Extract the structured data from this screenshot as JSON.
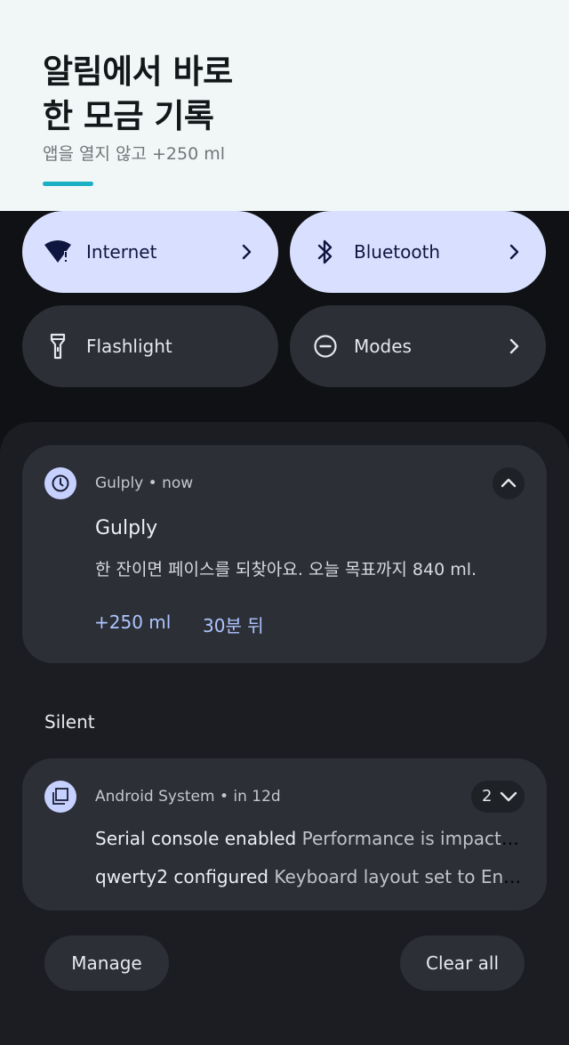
{
  "header": {
    "title_line1": "알림에서 바로",
    "title_line2": "한 모금 기록",
    "subtitle": "앱을 열지 않고 +250 ml"
  },
  "quick_settings": {
    "internet": {
      "label": "Internet",
      "icon": "wifi-warning-icon",
      "state": "on"
    },
    "bluetooth": {
      "label": "Bluetooth",
      "icon": "bluetooth-icon",
      "state": "on"
    },
    "flashlight": {
      "label": "Flashlight",
      "icon": "flashlight-icon",
      "state": "off"
    },
    "modes": {
      "label": "Modes",
      "icon": "do-not-disturb-icon",
      "state": "off"
    }
  },
  "notification": {
    "app": "Gulply",
    "separator": "•",
    "time": "now",
    "title": "Gulply",
    "text": "한 잔이면 페이스를 되찾아요. 오늘 목표까지 840 ml.",
    "actions": [
      "+250 ml",
      "30분 뒤"
    ]
  },
  "silent_section": {
    "label": "Silent",
    "group": {
      "app": "Android System",
      "separator": "•",
      "time": "in 12d",
      "count": "2",
      "rows": [
        {
          "title": "Serial console enabled",
          "text": "Performance is impacted. To disable, check bootloader."
        },
        {
          "title": "qwerty2 configured",
          "text": "Keyboard layout set to English (US). Tap to change."
        }
      ]
    }
  },
  "footer": {
    "manage": "Manage",
    "clear_all": "Clear all"
  },
  "colors": {
    "accent_bar": "#1ab0c4",
    "tile_on": "#d9e0ff",
    "tile_off": "#2c2f36",
    "action_text": "#aec5ff"
  }
}
